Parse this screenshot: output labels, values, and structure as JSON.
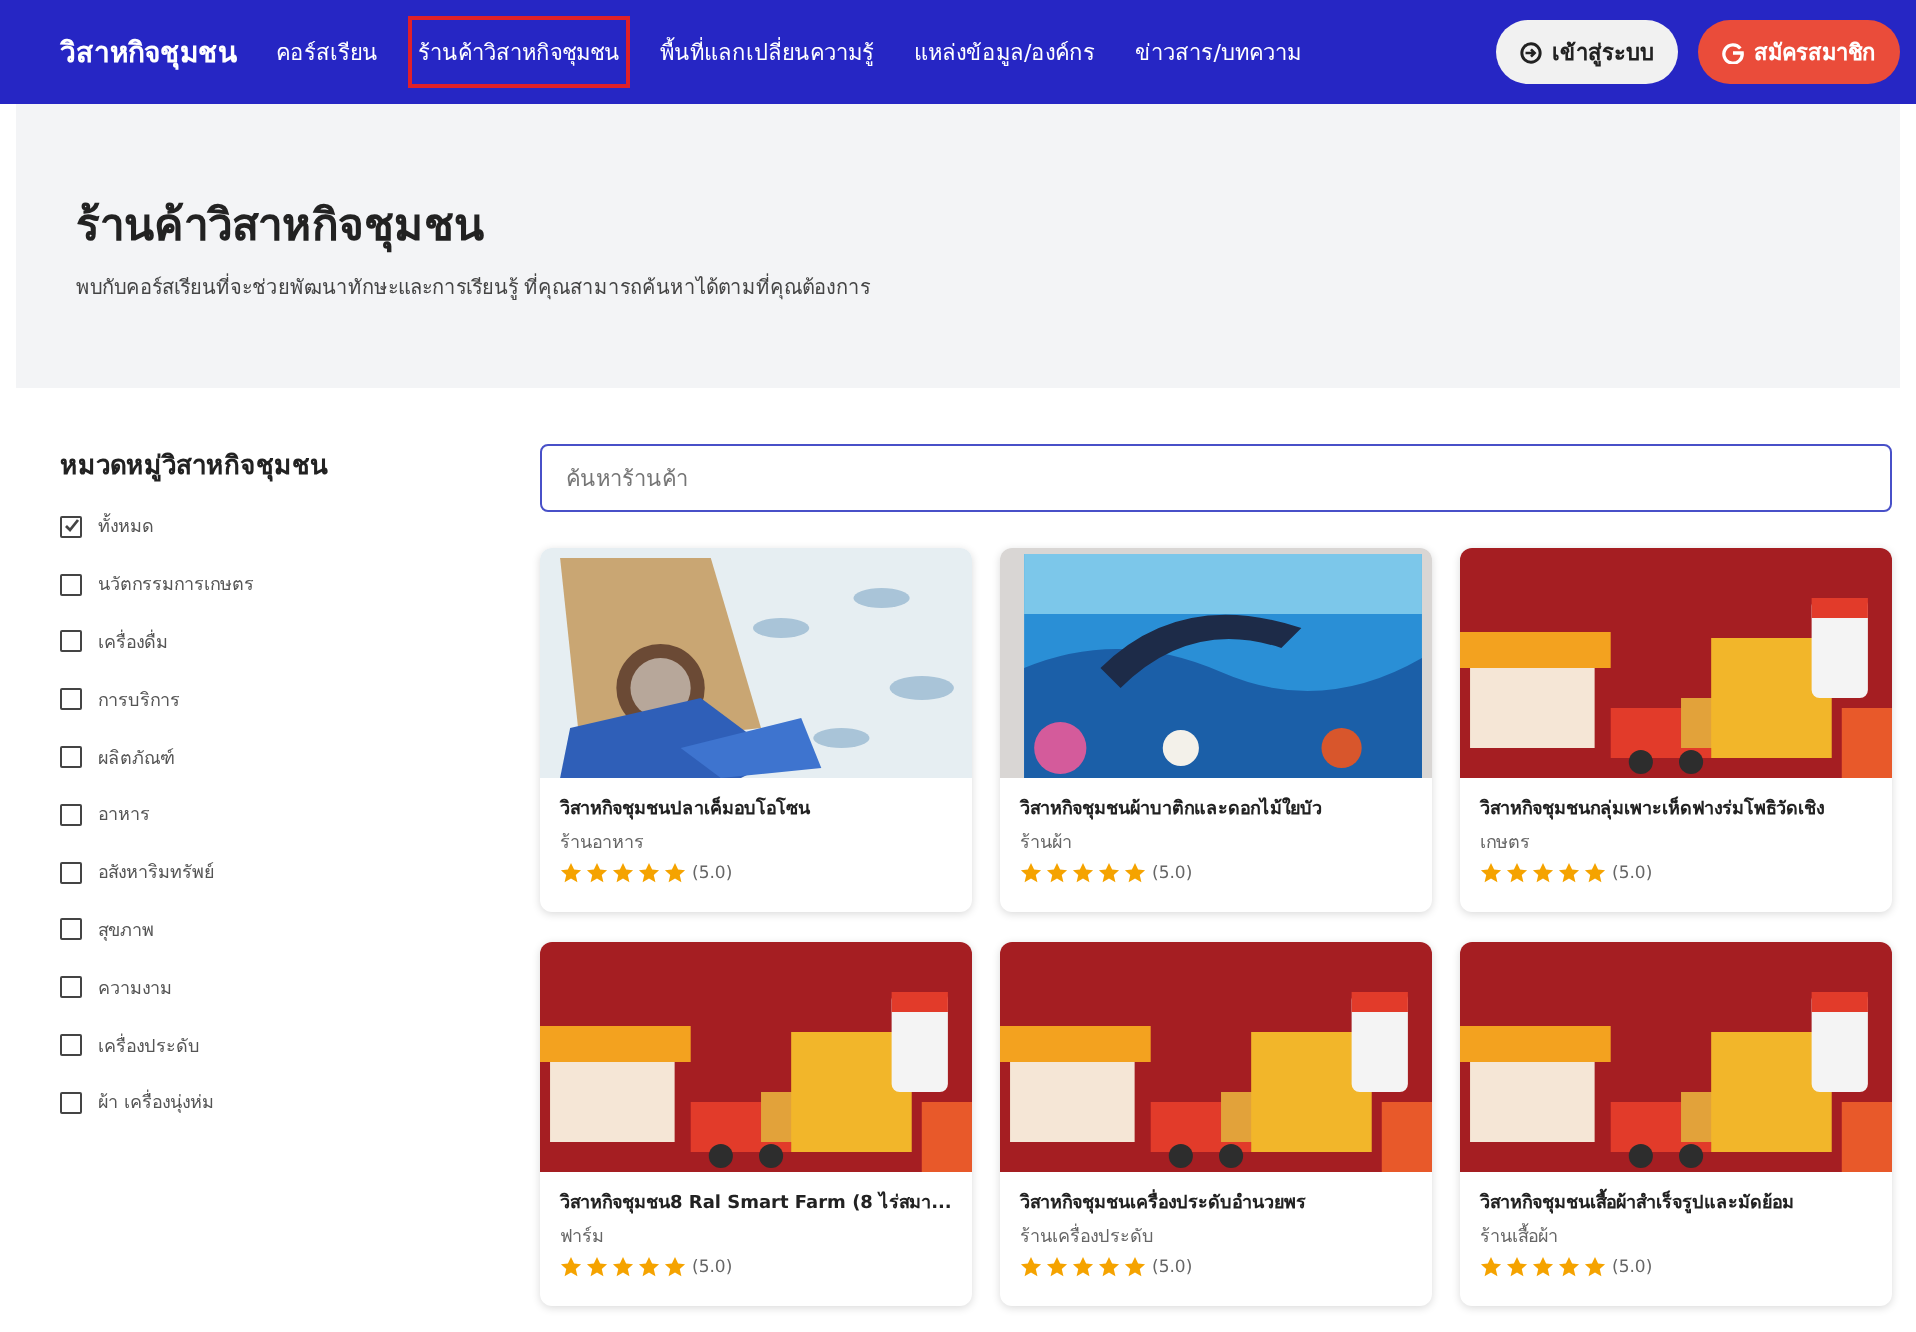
{
  "navbar": {
    "brand": "วิสาหกิจชุมชน",
    "links": [
      {
        "label": "คอร์สเรียน",
        "selected": false
      },
      {
        "label": "ร้านค้าวิสาหกิจชุมชน",
        "selected": true
      },
      {
        "label": "พื้นที่แลกเปลี่ยนความรู้",
        "selected": false
      },
      {
        "label": "แหล่งข้อมูล/องค์กร",
        "selected": false
      },
      {
        "label": "ข่าวสาร/บทความ",
        "selected": false
      }
    ],
    "login_button": "เข้าสู่ระบบ",
    "register_button": "สมัครสมาชิก"
  },
  "hero": {
    "title": "ร้านค้าวิสาหกิจชุมชน",
    "subtitle": "พบกับคอร์สเรียนที่จะช่วยพัฒนาทักษะและการเรียนรู้ ที่คุณสามารถค้นหาได้ตามที่คุณต้องการ"
  },
  "sidebar": {
    "title": "หมวดหมู่วิสาหกิจชุมชน",
    "categories": [
      {
        "label": "ทั้งหมด",
        "checked": true
      },
      {
        "label": "นวัตกรรมการเกษตร",
        "checked": false
      },
      {
        "label": "เครื่องดื่ม",
        "checked": false
      },
      {
        "label": "การบริการ",
        "checked": false
      },
      {
        "label": "ผลิตภัณฑ์",
        "checked": false
      },
      {
        "label": "อาหาร",
        "checked": false
      },
      {
        "label": "อสังหาริมทรัพย์",
        "checked": false
      },
      {
        "label": "สุขภาพ",
        "checked": false
      },
      {
        "label": "ความงาม",
        "checked": false
      },
      {
        "label": "เครื่องประดับ",
        "checked": false
      },
      {
        "label": "ผ้า เครื่องนุ่งห่ม",
        "checked": false
      }
    ]
  },
  "search": {
    "placeholder": "ค้นหาร้านค้า"
  },
  "products": [
    {
      "kind": "fish",
      "name": "วิสาหกิจชุมชนปลาเค็มอบโอโซน",
      "category": "ร้านอาหาร",
      "stars": 5,
      "rating": "(5.0)"
    },
    {
      "kind": "batik",
      "name": "วิสาหกิจชุมชนผ้าบาติกและดอกไม้ใยบัว",
      "category": "ร้านผ้า",
      "stars": 5,
      "rating": "(5.0)"
    },
    {
      "kind": "banner",
      "name": "วิสาหกิจชุมชนกลุ่มเพาะเห็ดฟางร่มโพธิวัดเชิง",
      "category": "เกษตร",
      "stars": 5,
      "rating": "(5.0)"
    },
    {
      "kind": "banner",
      "name": "วิสาหกิจชุมชน8 Ral Smart Farm (8 ไร่สมา...",
      "category": "ฟาร์ม",
      "stars": 5,
      "rating": "(5.0)"
    },
    {
      "kind": "banner",
      "name": "วิสาหกิจชุมชนเครื่องประดับอำนวยพร",
      "category": "ร้านเครื่องประดับ",
      "stars": 5,
      "rating": "(5.0)"
    },
    {
      "kind": "banner",
      "name": "วิสาหกิจชุมชนเสื้อผ้าสำเร็จรูปและมัดย้อม",
      "category": "ร้านเสื้อผ้า",
      "stars": 5,
      "rating": "(5.0)"
    }
  ]
}
